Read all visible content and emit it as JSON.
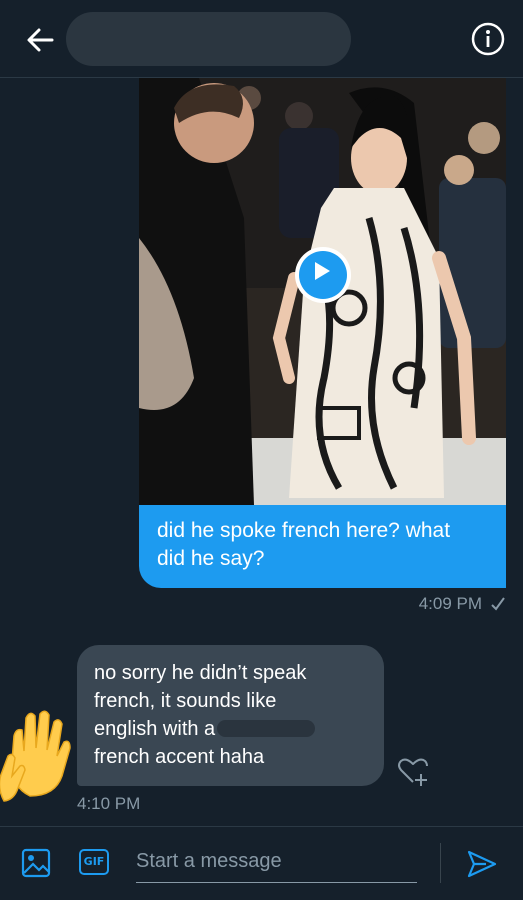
{
  "header": {
    "back_icon": "arrow-left-icon",
    "contact_name_redacted": true,
    "info_icon": "info-circle-icon"
  },
  "messages": [
    {
      "direction": "sent",
      "media": {
        "type": "video",
        "play_icon": "play-icon"
      },
      "text_lines": [
        "did he spoke french here? what",
        "did he say?"
      ],
      "time": "4:09 PM",
      "status_icon": "check-icon"
    },
    {
      "direction": "received",
      "text_lines": [
        "no sorry he didn’t speak",
        "french, it sounds like",
        "english with a",
        "french accent haha"
      ],
      "time": "4:10 PM",
      "reaction_icon": "waving-hands-emoji",
      "add_reaction_icon": "heart-plus-icon"
    }
  ],
  "composer": {
    "media_icon": "image-icon",
    "gif_label": "GIF",
    "placeholder": "Start a message",
    "value": "",
    "send_icon": "send-icon"
  },
  "colors": {
    "background": "#15202b",
    "accent": "#1d9bf0",
    "received_bubble": "#3a4753",
    "muted_text": "#8899a6"
  }
}
